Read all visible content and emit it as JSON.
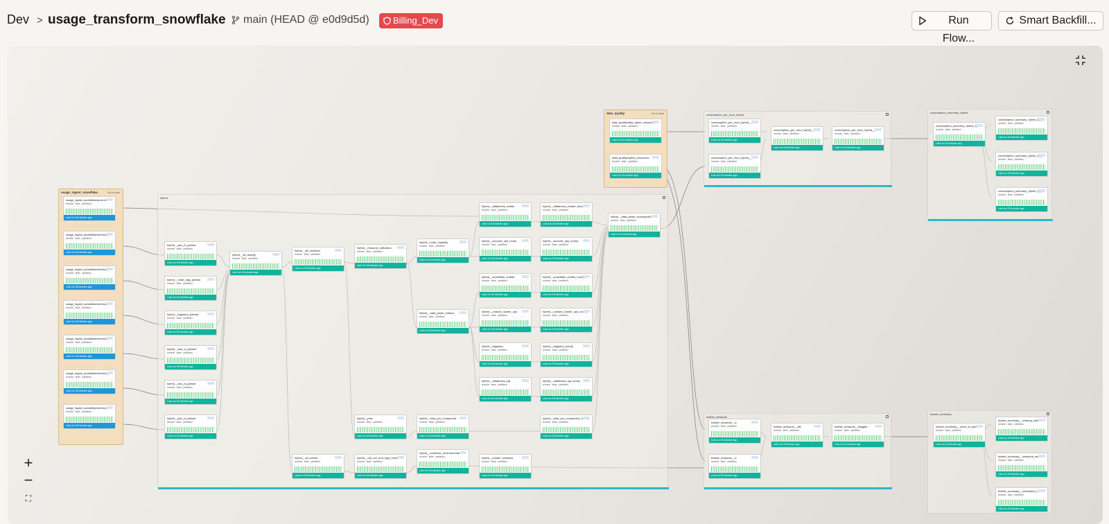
{
  "header": {
    "breadcrumb_root": "Dev",
    "breadcrumb_sep": ">",
    "title": "usage_transform_snowflake",
    "branch": "main (HEAD @ e0d9d5d)",
    "env_badge": "Billing_Dev",
    "run_flow": "Run Flow...",
    "smart_backfill": "Smart Backfill..."
  },
  "colors": {
    "accent_teal": "#11b39c",
    "badge_red": "#e5484d",
    "source_tan": "#f3dfbf",
    "group_bar": "#2bb9c9"
  },
  "icons": [
    "branch-icon",
    "shield-icon",
    "play-icon",
    "refresh-icon",
    "collapse-icon",
    "zoom-in-icon",
    "zoom-out-icon",
    "fit-view-icon"
  ],
  "zoom": {
    "in": "+",
    "out": "−",
    "fit": "⛶"
  },
  "dag": {
    "source_title": "usage_ingest_snowflake",
    "source_link": "Go to flow",
    "groups": {
      "hybrid": "hybrid",
      "dq": "data_quality",
      "cph": "consumption_per_hour_hybrid",
      "csh": "consumption_summary_hybrid",
      "bs": "builder_sessions",
      "bsum": "builder_summary"
    },
    "dq_link": "Go to flow",
    "nodes": [
      "usage_ingest_snowflake/account",
      "usage_ingest_snowflake/metrics_s",
      "usage_ingest_snowflake/metrics_l",
      "usage_ingest_snowflake/metrics_c",
      "usage_ingest_snowflake/metrics_t",
      "usage_ingest_snowflake/metrics_p",
      "usage_ingest_snowflake/metrics_d",
      "hybrid__gcs_vt_parsed",
      "hybrid__node_logs_parsed",
      "hybrid__bigquery_parsed",
      "hybrid__aws_vt_parsed",
      "hybrid__azs_vt_parsed",
      "hybrid__gcs_vt_parsed",
      "hybrid__all_activity",
      "hybrid__all_monitors",
      "hybrid__resource_utilization",
      "hybrid__node_capacity",
      "hybrid__data_plane_metrics",
      "hybrid__jobs",
      "hybrid__ultra_per_component",
      "hybrid__all_events",
      "hybrid__dot_run_and_logs_events",
      "hybrid__customer_environments",
      "hybrid__builder_sessions",
      "hybrid__databricks_cluster",
      "hybrid__account_ops_hours",
      "hybrid__snowflake_credits",
      "hybrid__unused_cluster_ops",
      "hybrid__bigquery",
      "hybrid__databricks_sql",
      "hybrid__databricks_cluster_hours",
      "hybrid__account_ops_hourly",
      "hybrid__snowflake_credits_hourly",
      "hybrid__unused_cluster_ops_hourly",
      "hybrid__bigquery_hourly",
      "hybrid__databricks_sql_hourly",
      "hybrid__ultra_per_component_hourly",
      "hybrid__data_plane_consumption",
      "data_quality/data_plane_consump",
      "data_quality/hybrid_resources",
      "consumption_per_hour_hybrid__a",
      "consumption_per_hour_hybrid__b",
      "consumption_per_hour_hybrid__d",
      "consumption_per_hour_hybrid__f",
      "consumption_summary_hybrid_by",
      "consumption_summary_hybrid_by_a",
      "consumption_summary_hybrid_by_b",
      "consumption_summary_hybrid_by_c",
      "builder_sessions__a",
      "builder_sessions__b",
      "builder_sessions__diff",
      "builder_sessions__flagged",
      "builder_summary__clock_to_date",
      "builder_summary__missing_users",
      "builder_summary__sessions_summ",
      "builder_summary__interested_n"
    ],
    "stat_labels": {
      "records": "records",
      "tests": "tests",
      "partitions": "partitions"
    },
    "last_run": "Last run 25 minutes ago"
  }
}
